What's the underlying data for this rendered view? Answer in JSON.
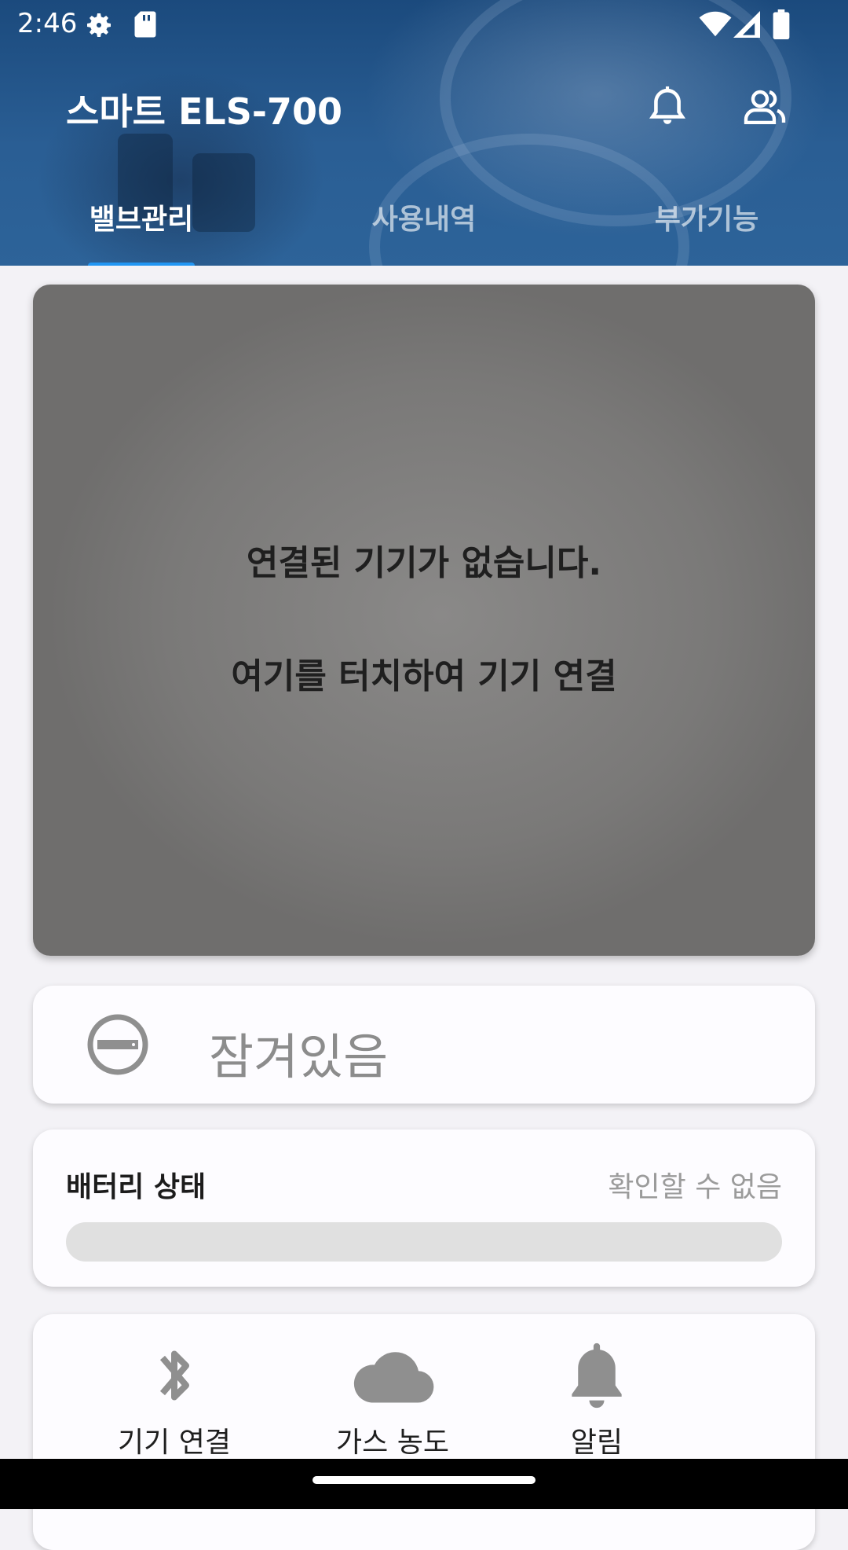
{
  "status_bar": {
    "time": "2:46",
    "icons": [
      "settings-gear-icon",
      "sd-card-icon",
      "wifi-icon",
      "cell-signal-icon",
      "battery-icon"
    ]
  },
  "header": {
    "title": "스마트 ELS-700",
    "actions": [
      "notification-bell-icon",
      "users-icon"
    ]
  },
  "tabs": [
    {
      "label": "밸브관리",
      "active": true
    },
    {
      "label": "사용내역",
      "active": false
    },
    {
      "label": "부가기능",
      "active": false
    }
  ],
  "device_card": {
    "message": "연결된 기기가 없습니다.",
    "hint": "여기를 터치하여 기기 연결"
  },
  "lock": {
    "icon": "lock-status-icon",
    "status": "잠겨있음"
  },
  "battery": {
    "label": "배터리 상태",
    "status": "확인할 수 없음",
    "level": 0
  },
  "quick_actions": [
    {
      "label": "기기 연결",
      "icon": "bluetooth-icon"
    },
    {
      "label": "가스 농도",
      "icon": "cloud-icon"
    },
    {
      "label": "알림",
      "icon": "bell-icon"
    }
  ],
  "colors": {
    "header": "#1b4a7d",
    "tab_indicator": "#2196f3",
    "card_bg": "#fdfcff",
    "device_card": "#7a7978",
    "icon_gray": "#8f8f8f"
  }
}
